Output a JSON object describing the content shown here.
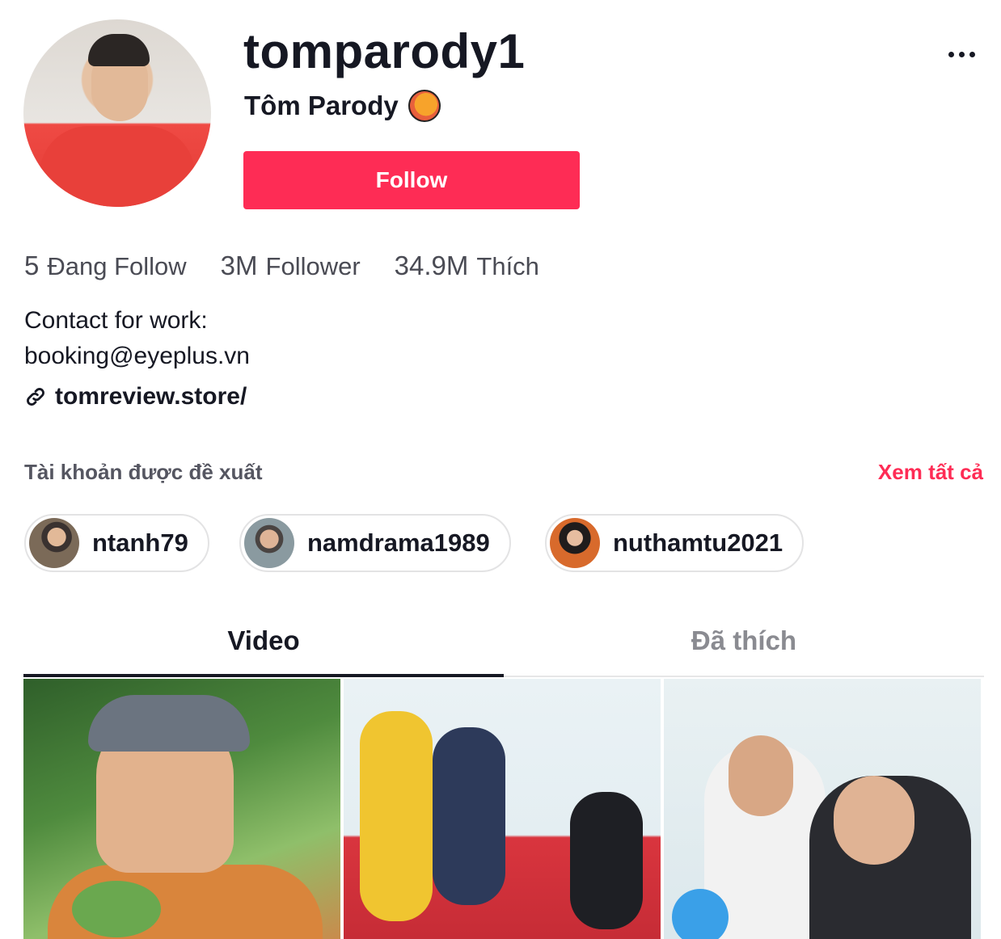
{
  "profile": {
    "username": "tomparody1",
    "nickname": "Tôm Parody",
    "follow_label": "Follow",
    "stats": [
      {
        "value": "5",
        "label": "Đang Follow"
      },
      {
        "value": "3M",
        "label": "Follower"
      },
      {
        "value": "34.9M",
        "label": "Thích"
      }
    ],
    "bio_line1": "Contact for work:",
    "bio_line2": "booking@eyeplus.vn",
    "link": "tomreview.store/"
  },
  "suggested": {
    "title": "Tài khoản được đề xuất",
    "see_all": "Xem tất cả",
    "accounts": [
      {
        "name": "ntanh79"
      },
      {
        "name": "namdrama1989"
      },
      {
        "name": "nuthamtu2021"
      }
    ]
  },
  "tabs": [
    {
      "label": "Video",
      "active": true
    },
    {
      "label": "Đã thích",
      "active": false
    }
  ],
  "colors": {
    "accent": "#fe2c55",
    "text": "#161823",
    "muted": "#8a8b91"
  },
  "icons": {
    "more": "more-horizontal-icon",
    "link": "link-icon",
    "badge": "shrimp-emoji-icon"
  }
}
